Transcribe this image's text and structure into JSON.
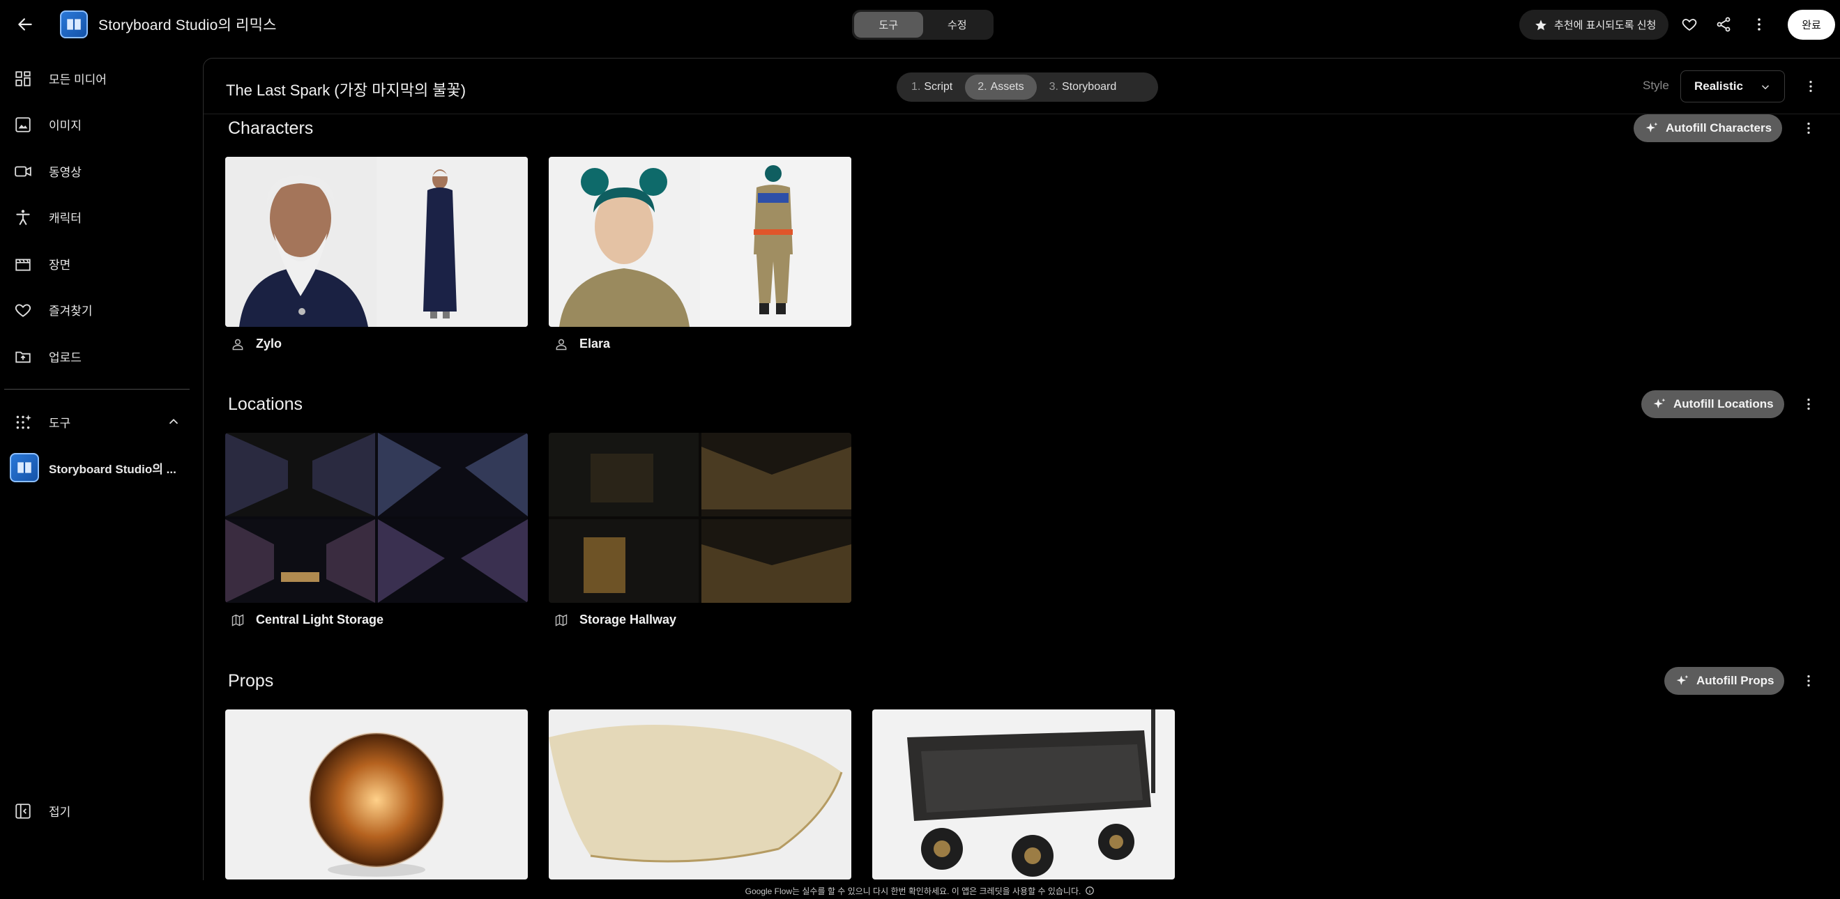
{
  "app": {
    "title": "Storyboard Studio의 리믹스"
  },
  "top_toggle": {
    "tools": "도구",
    "edit": "수정"
  },
  "top_actions": {
    "featured": "추천에 표시되도록 신청",
    "done": "완료"
  },
  "sidebar": {
    "items": [
      {
        "label": "모든 미디어",
        "icon": "grid-icon"
      },
      {
        "label": "이미지",
        "icon": "image-icon"
      },
      {
        "label": "동영상",
        "icon": "video-icon"
      },
      {
        "label": "캐릭터",
        "icon": "person-icon"
      },
      {
        "label": "장면",
        "icon": "clapper-icon"
      },
      {
        "label": "즐겨찾기",
        "icon": "heart-icon"
      },
      {
        "label": "업로드",
        "icon": "upload-folder-icon"
      }
    ],
    "tools_label": "도구",
    "tool_entry": "Storyboard Studio의 ...",
    "collapse": "접기"
  },
  "project": {
    "title": "The Last Spark (가장 마지막의 불꽃)",
    "steps": [
      {
        "num": "1.",
        "label": "Script"
      },
      {
        "num": "2.",
        "label": "Assets"
      },
      {
        "num": "3.",
        "label": "Storyboard"
      }
    ],
    "style_label": "Style",
    "style_value": "Realistic"
  },
  "sections": {
    "characters": {
      "title": "Characters",
      "autofill": "Autofill Characters",
      "items": [
        "Zylo",
        "Elara"
      ]
    },
    "locations": {
      "title": "Locations",
      "autofill": "Autofill Locations",
      "items": [
        "Central Light Storage",
        "Storage Hallway"
      ]
    },
    "props": {
      "title": "Props",
      "autofill": "Autofill Props"
    }
  },
  "footer": {
    "note": "Google Flow는 실수를 할 수 있으니 다시 한번 확인하세요. 이 앱은 크레딧을 사용할 수 있습니다."
  },
  "colors": {
    "background": "#000000",
    "panel_border": "#2e2e2e",
    "active_chip": "#5a5a5a",
    "button_bg": "#1f1f1f"
  }
}
